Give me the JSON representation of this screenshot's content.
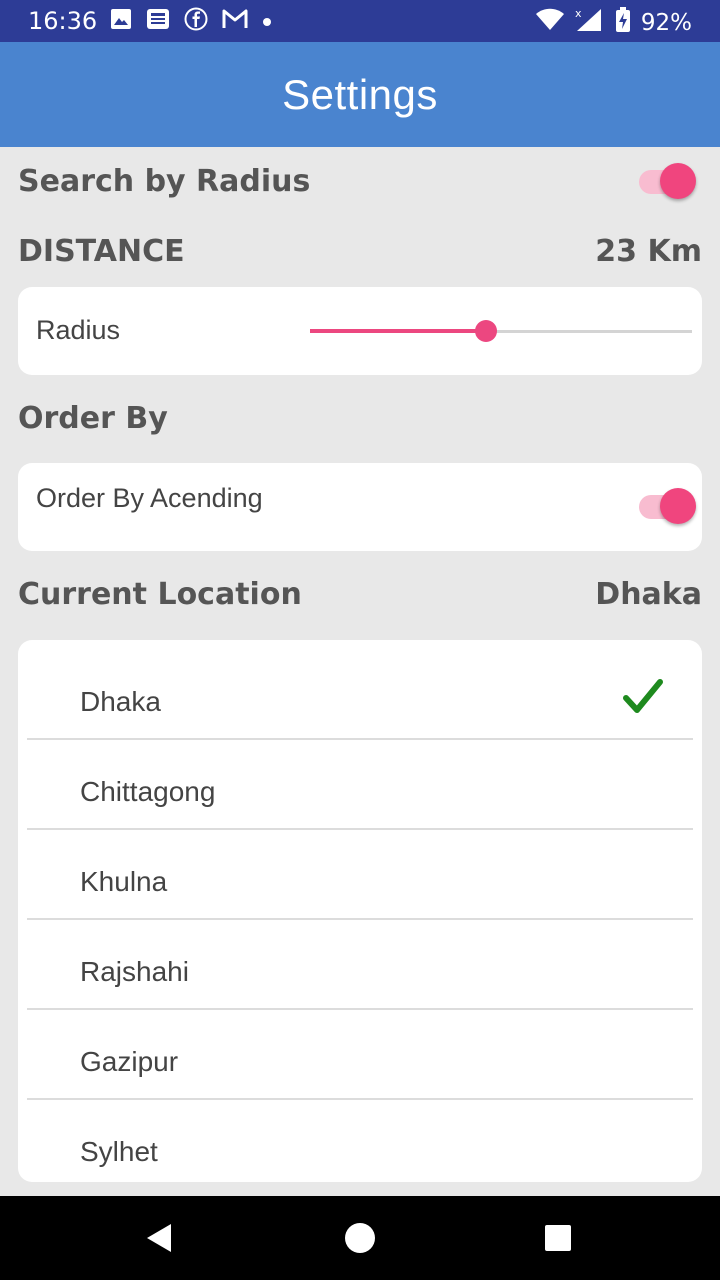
{
  "status_bar": {
    "time": "16:36",
    "battery_percent": "92%",
    "icons": [
      "image-icon",
      "news-icon",
      "facebook-icon",
      "gmail-icon",
      "dot-icon",
      "wifi-icon",
      "signal-icon",
      "battery-charging-icon"
    ]
  },
  "app_bar": {
    "title": "Settings"
  },
  "search_by_radius": {
    "label": "Search by Radius",
    "enabled": true
  },
  "distance": {
    "heading": "DISTANCE",
    "value_text": "23 Km",
    "radius_label": "Radius",
    "slider_fraction": 0.46
  },
  "order_by": {
    "heading": "Order By",
    "ascending_label": "Order By Acending",
    "ascending_enabled": true
  },
  "current_location": {
    "heading": "Current Location",
    "selected": "Dhaka",
    "options": [
      "Dhaka",
      "Chittagong",
      "Khulna",
      "Rajshahi",
      "Gazipur",
      "Sylhet"
    ]
  },
  "colors": {
    "status_bar": "#2d3c96",
    "app_bar": "#4a84cf",
    "accent": "#f0457e",
    "check": "#1e8a1e"
  }
}
